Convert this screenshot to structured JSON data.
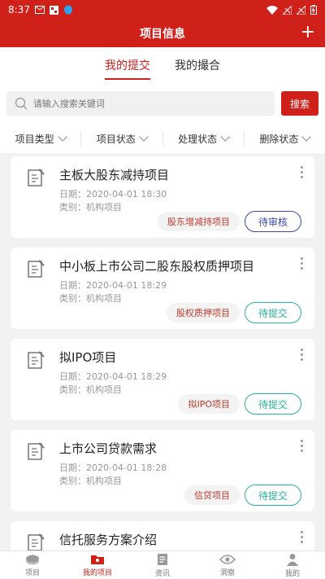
{
  "status_bar": {
    "time": "8:37"
  },
  "header": {
    "title": "项目信息",
    "add_label": "+"
  },
  "tabs": [
    {
      "label": "我的提交",
      "active": true
    },
    {
      "label": "我的撮合",
      "active": false
    }
  ],
  "search": {
    "placeholder": "请输入搜索关键词",
    "button_label": "搜索"
  },
  "filters": [
    {
      "label": "项目类型"
    },
    {
      "label": "项目状态"
    },
    {
      "label": "处理状态"
    },
    {
      "label": "删除状态"
    }
  ],
  "projects": [
    {
      "title": "主板大股东减持项目",
      "date": "日期：2020-04-01 18:30",
      "category": "类别：机构项目",
      "tag": "股东增减持项目",
      "status": "待审核",
      "status_type": "review"
    },
    {
      "title": "中小板上市公司二股东股权质押项目",
      "date": "日期：2020-04-01 18:29",
      "category": "类别：机构项目",
      "tag": "股权质押项目",
      "status": "待提交",
      "status_type": "submit"
    },
    {
      "title": "拟IPO项目",
      "date": "日期：2020-04-01 18:29",
      "category": "类别：机构项目",
      "tag": "拟IPO项目",
      "status": "待提交",
      "status_type": "submit"
    },
    {
      "title": "上市公司贷款需求",
      "date": "日期：2020-04-01 18:28",
      "category": "类别：机构项目",
      "tag": "信贷项目",
      "status": "待提交",
      "status_type": "submit"
    },
    {
      "title": "信托服务方案介绍",
      "date": "",
      "category": "",
      "tag": "",
      "status": "",
      "status_type": ""
    }
  ],
  "bottom_nav": [
    {
      "label": "项目",
      "icon": "layers-icon",
      "active": false
    },
    {
      "label": "我的项目",
      "icon": "folder-user-icon",
      "active": true
    },
    {
      "label": "资讯",
      "icon": "document-icon",
      "active": false
    },
    {
      "label": "洞察",
      "icon": "eye-icon",
      "active": false
    },
    {
      "label": "我的",
      "icon": "person-icon",
      "active": false
    }
  ],
  "colors": {
    "brand": "#d0201a",
    "review": "#3b4aa9",
    "submit": "#2bb39a"
  }
}
